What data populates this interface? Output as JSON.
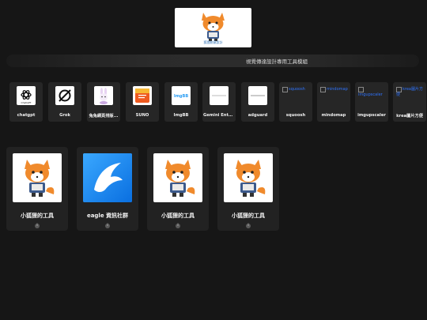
{
  "header": {
    "logo_caption": "狐狸創意設計"
  },
  "banner": {
    "title": "視覺傳達設計專用工具模組"
  },
  "tools": [
    {
      "label": "chatgpt",
      "icon": "openai-icon"
    },
    {
      "label": "Grok",
      "icon": "grok-icon"
    },
    {
      "label": "兔兔網頁排版...",
      "icon": "rabbit-icon"
    },
    {
      "label": "SUNO",
      "icon": "suno-icon"
    },
    {
      "label": "ImgBB",
      "icon": "imgbb-icon"
    },
    {
      "label": "Gemini Enter...",
      "icon": "gemini-icon"
    },
    {
      "label": "adguard",
      "icon": "adguard-icon"
    },
    {
      "label": "squoosh",
      "icon": "broken-image-icon",
      "alt": "squoosh"
    },
    {
      "label": "mindomap",
      "icon": "broken-image-icon",
      "alt": "mindomap"
    },
    {
      "label": "imgupscaler",
      "icon": "broken-image-icon",
      "alt": "imgupscaler"
    },
    {
      "label": "krea圖片方便",
      "icon": "broken-image-icon",
      "alt": "krea圖片方便"
    }
  ],
  "cards": [
    {
      "title": "小狐狸的工具",
      "info": "i"
    },
    {
      "title": "eagle 資訊社群",
      "info": "i"
    },
    {
      "title": "小狐狸的工具",
      "info": "i"
    },
    {
      "title": "小狐狸的工具",
      "info": "i"
    }
  ],
  "colors": {
    "background": "#161616",
    "tile": "#262626",
    "card": "#222222",
    "eagle_blue": "#1e8ff5",
    "fox_orange": "#f08a2c"
  }
}
